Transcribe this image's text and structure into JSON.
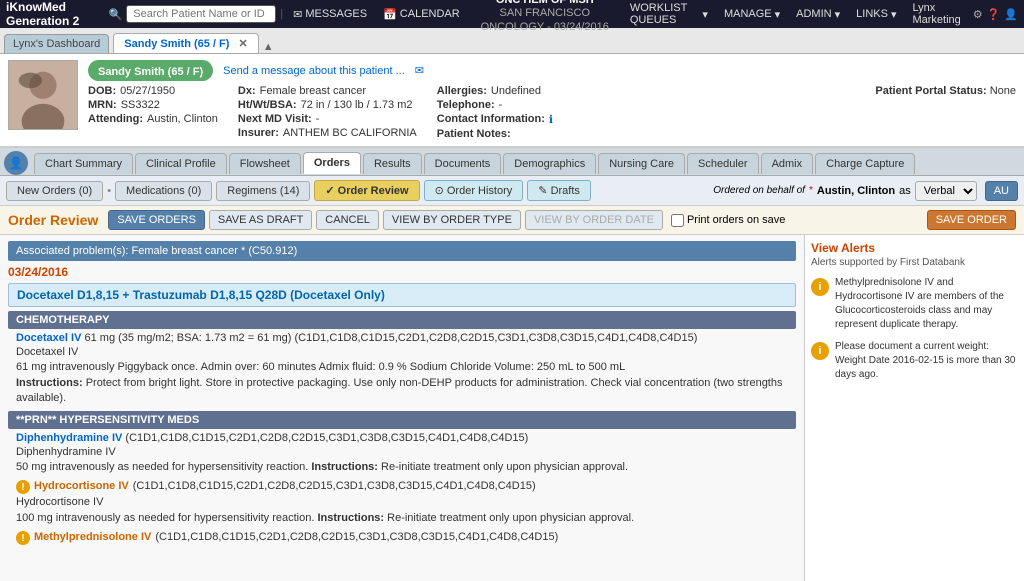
{
  "app": {
    "brand": "iKnowMed Generation 2",
    "search_placeholder": "Search Patient Name or ID"
  },
  "nav": {
    "messages": "MESSAGES",
    "calendar": "CALENDAR",
    "clinic_name": "ONC HEM OF MSH",
    "clinic_sub": "SAN FRANCISCO ONCOLOGY - 03/24/2016",
    "worklist": "WORKLIST QUEUES",
    "manage": "MANAGE",
    "admin": "ADMIN",
    "links": "LINKS",
    "marketing": "Lynx Marketing"
  },
  "tabs": {
    "dashboard": "Lynx's Dashboard",
    "patient_tab": "Sandy Smith (65 / F)"
  },
  "patient": {
    "name": "Sandy Smith (65 / F)",
    "message_link": "Send a message about this patient ...",
    "dob_label": "DOB:",
    "dob": "05/27/1950",
    "mrn_label": "MRN:",
    "mrn": "SS3322",
    "attending_label": "Attending:",
    "attending": "Austin, Clinton",
    "dx_label": "Dx:",
    "dx": "Female breast cancer",
    "ht_label": "Ht/Wt/BSA:",
    "ht": "72 in / 130 lb / 1.73 m2",
    "next_md_label": "Next MD Visit:",
    "next_md": "-",
    "insurer_label": "Insurer:",
    "insurer": "ANTHEM BC CALIFORNIA",
    "allergies_label": "Allergies:",
    "allergies": "Undefined",
    "telephone_label": "Telephone:",
    "telephone": "-",
    "contact_label": "Contact Information:",
    "patient_notes_label": "Patient Notes:",
    "portal_label": "Patient Portal Status:",
    "portal_value": "None"
  },
  "nav_tabs": {
    "items": [
      "Chart Summary",
      "Clinical Profile",
      "Flowsheet",
      "Orders",
      "Results",
      "Documents",
      "Demographics",
      "Nursing Care",
      "Scheduler",
      "Admix",
      "Charge Capture"
    ],
    "active": "Orders"
  },
  "order_subtabs": {
    "new_orders": "New Orders (0)",
    "medications": "Medications (0)",
    "regimens": "Regimens (14)",
    "order_review": "Order Review",
    "order_history": "Order History",
    "drafts": "Drafts",
    "ordered_behalf_label": "Ordered on behalf of",
    "ordered_behalf_value": "Austin, Clinton",
    "as_label": "as",
    "verbal_option": "Verbal"
  },
  "toolbar": {
    "title": "Order Review",
    "save_orders": "SAVE ORDERS",
    "save_as_draft": "SAVE AS DRAFT",
    "cancel": "CANCEL",
    "view_by_order_type": "VIEW BY ORDER TYPE",
    "view_by_order_date": "VIEW BY ORDER DATE",
    "print_label": "Print orders on save",
    "save_order_right": "SAVE ORDER"
  },
  "orders": {
    "associated_problems": "Associated problem(s): Female breast cancer * (C50.912)",
    "date": "03/24/2016",
    "regimen_name": "Docetaxel D1,8,15 + Trastuzumab D1,8,15 Q28D (Docetaxel Only)",
    "sections": [
      {
        "header": "CHEMOTHERAPY",
        "drugs": [
          {
            "name": "Docetaxel IV",
            "dose_info": "61 mg (35 mg/m2; BSA: 1.73 m2 = 61 mg) (C1D1,C1D8,C1D15,C2D1,C2D8,C2D15,C3D1,C3D8,C3D15,C4D1,C4D8,C4D15)",
            "detail": "Docetaxel IV",
            "detail2": "61 mg intravenously Piggyback once. Admin over: 60 minutes Admix fluid: 0.9 % Sodium Chloride Volume: 250 mL to 500 mL",
            "instructions": "Instructions:",
            "instructions_text": "Protect from bright light. Store in protective packaging. Use only non-DEHP products for administration. Check vial concentration (two strengths available).",
            "warning": false
          }
        ]
      },
      {
        "header": "**PRN** HYPERSENSITIVITY MEDS",
        "drugs": [
          {
            "name": "Diphenhydramine IV",
            "dose_info": "(C1D1,C1D8,C1D15,C2D1,C2D8,C2D15,C3D1,C3D8,C3D15,C4D1,C4D8,C4D15)",
            "detail": "Diphenhydramine IV",
            "detail2": "50 mg intravenously as needed for hypersensitivity reaction.",
            "instructions": "Instructions:",
            "instructions_text": "Re-initiate treatment only upon physician approval.",
            "warning": false
          },
          {
            "name": "Hydrocortisone IV",
            "dose_info": "(C1D1,C1D8,C1D15,C2D1,C2D8,C2D15,C3D1,C3D8,C3D15,C4D1,C4D8,C4D15)",
            "detail": "Hydrocortisone IV",
            "detail2": "100 mg intravenously as needed for hypersensitivity reaction.",
            "instructions": "Instructions:",
            "instructions_text": "Re-initiate treatment only upon physician approval.",
            "warning": true
          },
          {
            "name": "Methylprednisolone IV",
            "dose_info": "(C1D1,C1D8,C1D15,C2D1,C2D8,C2D15,C3D1,C3D8,C3D15,C4D1,C4D8,C4D15)",
            "detail": "",
            "detail2": "",
            "instructions": "",
            "instructions_text": "",
            "warning": true
          }
        ]
      }
    ]
  },
  "alerts": {
    "title": "View Alerts",
    "subtitle": "Alerts supported by First Databank",
    "items": [
      {
        "icon": "i",
        "text": "Methylprednisolone IV and Hydrocortisone IV are members of the Glucocorticosteroids class and may represent duplicate therapy."
      },
      {
        "icon": "i",
        "text": "Please document a current weight: Weight Date 2016-02-15 is more than 30 days ago."
      }
    ]
  }
}
